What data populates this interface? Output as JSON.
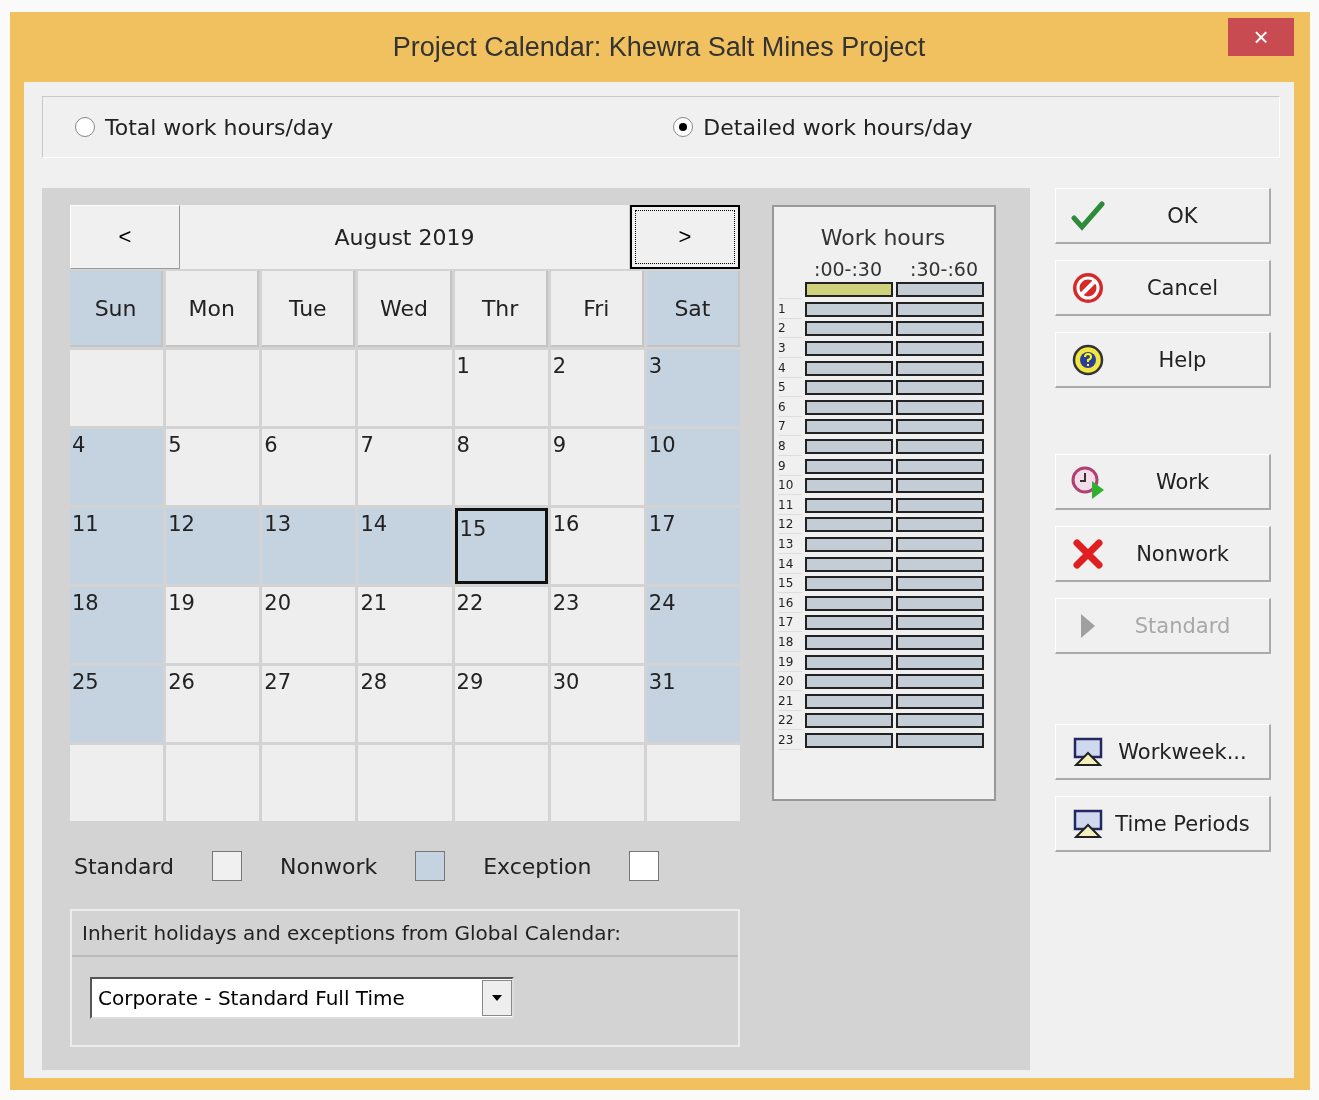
{
  "window": {
    "title": "Project Calendar: Khewra Salt Mines Project",
    "close": "×"
  },
  "mode_options": [
    {
      "label": "Total work hours/day",
      "selected": false
    },
    {
      "label": "Detailed work hours/day",
      "selected": true
    }
  ],
  "calendar": {
    "prev": "<",
    "month": "August 2019",
    "next": ">",
    "weekdays": [
      {
        "label": "Sun",
        "nonwork": true
      },
      {
        "label": "Mon",
        "nonwork": false
      },
      {
        "label": "Tue",
        "nonwork": false
      },
      {
        "label": "Wed",
        "nonwork": false
      },
      {
        "label": "Thr",
        "nonwork": false
      },
      {
        "label": "Fri",
        "nonwork": false
      },
      {
        "label": "Sat",
        "nonwork": true
      }
    ],
    "weeks": [
      [
        {
          "kind": "blank",
          "nonwork": false
        },
        {
          "kind": "blank",
          "nonwork": false
        },
        {
          "kind": "blank",
          "nonwork": false
        },
        {
          "kind": "blank",
          "nonwork": false
        },
        {
          "kind": "day",
          "day": "1",
          "nonwork": false,
          "selected": false
        },
        {
          "kind": "day",
          "day": "2",
          "nonwork": false,
          "selected": false
        },
        {
          "kind": "day",
          "day": "3",
          "nonwork": true,
          "selected": false
        }
      ],
      [
        {
          "kind": "day",
          "day": "4",
          "nonwork": true,
          "selected": false
        },
        {
          "kind": "day",
          "day": "5",
          "nonwork": false,
          "selected": false
        },
        {
          "kind": "day",
          "day": "6",
          "nonwork": false,
          "selected": false
        },
        {
          "kind": "day",
          "day": "7",
          "nonwork": false,
          "selected": false
        },
        {
          "kind": "day",
          "day": "8",
          "nonwork": false,
          "selected": false
        },
        {
          "kind": "day",
          "day": "9",
          "nonwork": false,
          "selected": false
        },
        {
          "kind": "day",
          "day": "10",
          "nonwork": true,
          "selected": false
        }
      ],
      [
        {
          "kind": "day",
          "day": "11",
          "nonwork": true,
          "selected": false
        },
        {
          "kind": "day",
          "day": "12",
          "nonwork": true,
          "selected": false
        },
        {
          "kind": "day",
          "day": "13",
          "nonwork": true,
          "selected": false
        },
        {
          "kind": "day",
          "day": "14",
          "nonwork": true,
          "selected": false
        },
        {
          "kind": "day",
          "day": "15",
          "nonwork": true,
          "selected": true
        },
        {
          "kind": "day",
          "day": "16",
          "nonwork": false,
          "selected": false
        },
        {
          "kind": "day",
          "day": "17",
          "nonwork": true,
          "selected": false
        }
      ],
      [
        {
          "kind": "day",
          "day": "18",
          "nonwork": true,
          "selected": false
        },
        {
          "kind": "day",
          "day": "19",
          "nonwork": false,
          "selected": false
        },
        {
          "kind": "day",
          "day": "20",
          "nonwork": false,
          "selected": false
        },
        {
          "kind": "day",
          "day": "21",
          "nonwork": false,
          "selected": false
        },
        {
          "kind": "day",
          "day": "22",
          "nonwork": false,
          "selected": false
        },
        {
          "kind": "day",
          "day": "23",
          "nonwork": false,
          "selected": false
        },
        {
          "kind": "day",
          "day": "24",
          "nonwork": true,
          "selected": false
        }
      ],
      [
        {
          "kind": "day",
          "day": "25",
          "nonwork": true,
          "selected": false
        },
        {
          "kind": "day",
          "day": "26",
          "nonwork": false,
          "selected": false
        },
        {
          "kind": "day",
          "day": "27",
          "nonwork": false,
          "selected": false
        },
        {
          "kind": "day",
          "day": "28",
          "nonwork": false,
          "selected": false
        },
        {
          "kind": "day",
          "day": "29",
          "nonwork": false,
          "selected": false
        },
        {
          "kind": "day",
          "day": "30",
          "nonwork": false,
          "selected": false
        },
        {
          "kind": "day",
          "day": "31",
          "nonwork": true,
          "selected": false
        }
      ],
      [
        {
          "kind": "blank",
          "nonwork": false
        },
        {
          "kind": "blank",
          "nonwork": false
        },
        {
          "kind": "blank",
          "nonwork": false
        },
        {
          "kind": "blank",
          "nonwork": false
        },
        {
          "kind": "blank",
          "nonwork": false
        },
        {
          "kind": "blank",
          "nonwork": false
        },
        {
          "kind": "blank",
          "nonwork": false
        }
      ]
    ]
  },
  "work_hours": {
    "title": "Work hours",
    "columns": [
      ":00-:30",
      ":30-:60"
    ],
    "rows": [
      {
        "slots": [
          {
            "selected": true,
            "nonwork": true
          },
          {
            "selected": false,
            "nonwork": true
          }
        ]
      },
      {
        "label": "1",
        "slots": [
          {
            "selected": false,
            "nonwork": true
          },
          {
            "selected": false,
            "nonwork": true
          }
        ]
      },
      {
        "label": "2",
        "slots": [
          {
            "selected": false,
            "nonwork": true
          },
          {
            "selected": false,
            "nonwork": true
          }
        ]
      },
      {
        "label": "3",
        "slots": [
          {
            "selected": false,
            "nonwork": true
          },
          {
            "selected": false,
            "nonwork": true
          }
        ]
      },
      {
        "label": "4",
        "slots": [
          {
            "selected": false,
            "nonwork": true
          },
          {
            "selected": false,
            "nonwork": true
          }
        ]
      },
      {
        "label": "5",
        "slots": [
          {
            "selected": false,
            "nonwork": true
          },
          {
            "selected": false,
            "nonwork": true
          }
        ]
      },
      {
        "label": "6",
        "slots": [
          {
            "selected": false,
            "nonwork": true
          },
          {
            "selected": false,
            "nonwork": true
          }
        ]
      },
      {
        "label": "7",
        "slots": [
          {
            "selected": false,
            "nonwork": true
          },
          {
            "selected": false,
            "nonwork": true
          }
        ]
      },
      {
        "label": "8",
        "slots": [
          {
            "selected": false,
            "nonwork": true
          },
          {
            "selected": false,
            "nonwork": true
          }
        ]
      },
      {
        "label": "9",
        "slots": [
          {
            "selected": false,
            "nonwork": true
          },
          {
            "selected": false,
            "nonwork": true
          }
        ]
      },
      {
        "label": "10",
        "slots": [
          {
            "selected": false,
            "nonwork": true
          },
          {
            "selected": false,
            "nonwork": true
          }
        ]
      },
      {
        "label": "11",
        "slots": [
          {
            "selected": false,
            "nonwork": true
          },
          {
            "selected": false,
            "nonwork": true
          }
        ]
      },
      {
        "label": "12",
        "slots": [
          {
            "selected": false,
            "nonwork": true
          },
          {
            "selected": false,
            "nonwork": true
          }
        ]
      },
      {
        "label": "13",
        "slots": [
          {
            "selected": false,
            "nonwork": true
          },
          {
            "selected": false,
            "nonwork": true
          }
        ]
      },
      {
        "label": "14",
        "slots": [
          {
            "selected": false,
            "nonwork": true
          },
          {
            "selected": false,
            "nonwork": true
          }
        ]
      },
      {
        "label": "15",
        "slots": [
          {
            "selected": false,
            "nonwork": true
          },
          {
            "selected": false,
            "nonwork": true
          }
        ]
      },
      {
        "label": "16",
        "slots": [
          {
            "selected": false,
            "nonwork": true
          },
          {
            "selected": false,
            "nonwork": true
          }
        ]
      },
      {
        "label": "17",
        "slots": [
          {
            "selected": false,
            "nonwork": true
          },
          {
            "selected": false,
            "nonwork": true
          }
        ]
      },
      {
        "label": "18",
        "slots": [
          {
            "selected": false,
            "nonwork": true
          },
          {
            "selected": false,
            "nonwork": true
          }
        ]
      },
      {
        "label": "19",
        "slots": [
          {
            "selected": false,
            "nonwork": true
          },
          {
            "selected": false,
            "nonwork": true
          }
        ]
      },
      {
        "label": "20",
        "slots": [
          {
            "selected": false,
            "nonwork": true
          },
          {
            "selected": false,
            "nonwork": true
          }
        ]
      },
      {
        "label": "21",
        "slots": [
          {
            "selected": false,
            "nonwork": true
          },
          {
            "selected": false,
            "nonwork": true
          }
        ]
      },
      {
        "label": "22",
        "slots": [
          {
            "selected": false,
            "nonwork": true
          },
          {
            "selected": false,
            "nonwork": true
          }
        ]
      },
      {
        "label": "23",
        "slots": [
          {
            "selected": false,
            "nonwork": true
          },
          {
            "selected": false,
            "nonwork": true
          }
        ]
      }
    ]
  },
  "legend": [
    {
      "label": "Standard",
      "color": "#f0f0f0"
    },
    {
      "label": "Nonwork",
      "color": "#c5d3e0"
    },
    {
      "label": "Exception",
      "color": "#ffffff"
    }
  ],
  "inherit": {
    "label": "Inherit holidays and exceptions from Global Calendar:",
    "value": "Corporate - Standard Full Time"
  },
  "buttons": [
    {
      "kind": "ok",
      "label": "OK",
      "disabled": false
    },
    {
      "kind": "cancel",
      "label": "Cancel",
      "disabled": false
    },
    {
      "kind": "help",
      "label": "Help",
      "disabled": false
    },
    {
      "kind": "work",
      "label": "Work",
      "disabled": false
    },
    {
      "kind": "nonwork",
      "label": "Nonwork",
      "disabled": false
    },
    {
      "kind": "standard",
      "label": "Standard",
      "disabled": true
    },
    {
      "kind": "workweek",
      "label": "Workweek...",
      "disabled": false
    },
    {
      "kind": "periods",
      "label": "Time Periods",
      "disabled": false
    }
  ]
}
